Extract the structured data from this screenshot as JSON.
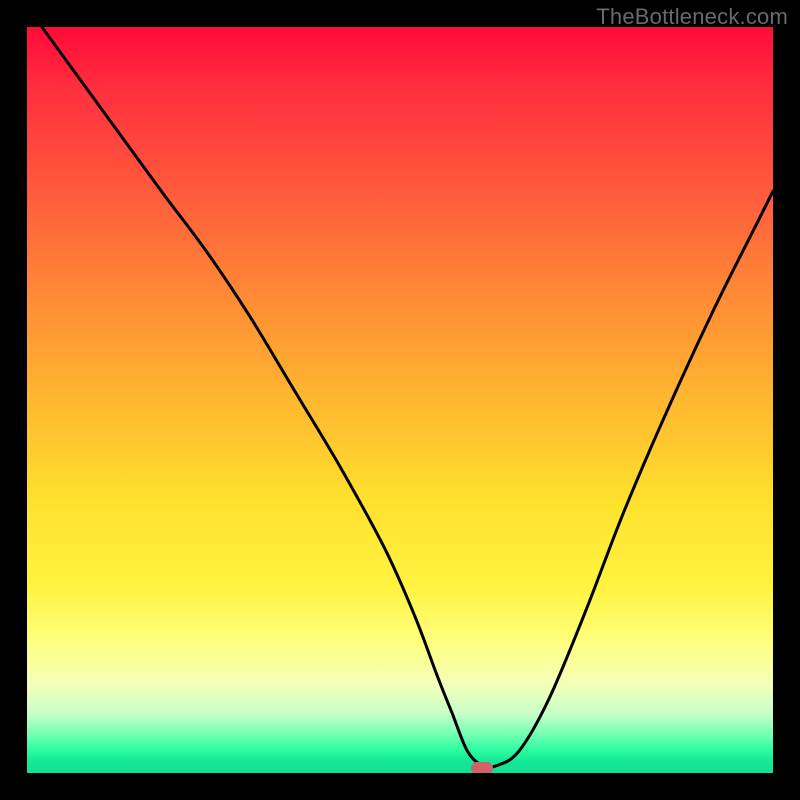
{
  "watermark": "TheBottleneck.com",
  "colors": {
    "frame": "#000000",
    "curve_stroke": "#000000",
    "marker": "#d1626c",
    "watermark_text": "#6a6a6a"
  },
  "chart_data": {
    "type": "line",
    "title": "",
    "xlabel": "",
    "ylabel": "",
    "xlim": [
      0,
      100
    ],
    "ylim": [
      0,
      100
    ],
    "grid": false,
    "legend": false,
    "background": "vertical-gradient red→orange→yellow→pale-yellow→green",
    "series": [
      {
        "name": "bottleneck-curve",
        "x": [
          2,
          10,
          18,
          24,
          30,
          36,
          42,
          48,
          52,
          55,
          57,
          59,
          61,
          63,
          66,
          70,
          75,
          80,
          86,
          92,
          98,
          100
        ],
        "values": [
          100,
          89,
          78,
          70,
          61,
          51,
          41,
          30,
          21,
          13,
          8,
          3,
          1,
          1,
          3,
          10,
          22,
          35,
          49,
          62,
          74,
          78
        ]
      }
    ],
    "marker": {
      "x": 61,
      "y": 0.7,
      "shape": "pill",
      "color": "#d1626c"
    }
  }
}
